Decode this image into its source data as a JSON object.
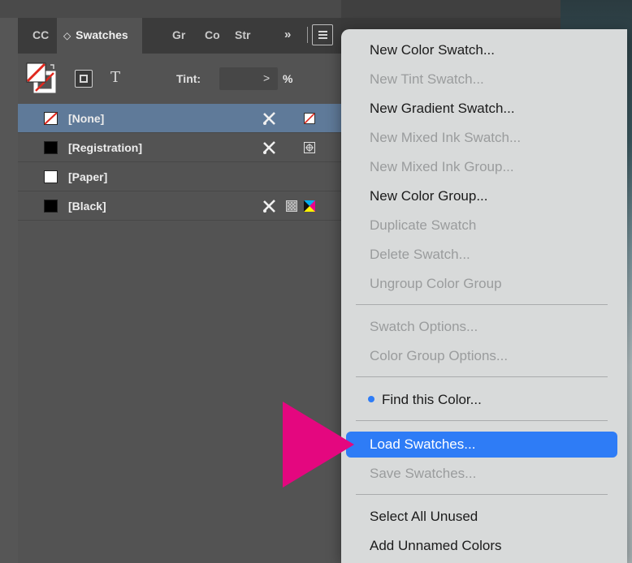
{
  "panel": {
    "tabs": [
      {
        "label": "CC"
      },
      {
        "label": "Swatches",
        "active": true,
        "sort_icon": "◇"
      },
      {
        "label": "Gr"
      },
      {
        "label": "Co"
      },
      {
        "label": "Str"
      }
    ],
    "more_label": "»",
    "tint_label": "Tint:",
    "tint_value": "",
    "tint_arrow": ">",
    "tint_percent": "%",
    "text_btn": "T",
    "swatches": [
      {
        "name": "[None]",
        "chip_color": "#ffffff",
        "selected": true,
        "type_icon": "none-icon"
      },
      {
        "name": "[Registration]",
        "chip_color": "#000000",
        "type_icon": "registration-icon"
      },
      {
        "name": "[Paper]",
        "chip_color": "#ffffff"
      },
      {
        "name": "[Black]",
        "chip_color": "#000000",
        "type_icon": "process-cmyk-icon"
      }
    ]
  },
  "menu": {
    "items": [
      {
        "label": "New Color Swatch...",
        "enabled": true
      },
      {
        "label": "New Tint Swatch...",
        "enabled": false
      },
      {
        "label": "New Gradient Swatch...",
        "enabled": true
      },
      {
        "label": "New Mixed Ink Swatch...",
        "enabled": false
      },
      {
        "label": "New Mixed Ink Group...",
        "enabled": false
      },
      {
        "label": "New Color Group...",
        "enabled": true
      },
      {
        "label": "Duplicate Swatch",
        "enabled": false
      },
      {
        "label": "Delete Swatch...",
        "enabled": false
      },
      {
        "label": "Ungroup Color Group",
        "enabled": false
      },
      {
        "label": "Swatch Options...",
        "enabled": false
      },
      {
        "label": "Color Group Options...",
        "enabled": false
      },
      {
        "label": "Find this Color...",
        "enabled": true,
        "bullet": true
      },
      {
        "label": "Load Swatches...",
        "enabled": true,
        "highlighted": true
      },
      {
        "label": "Save Swatches...",
        "enabled": false
      },
      {
        "label": "Select All Unused",
        "enabled": true
      },
      {
        "label": "Add Unnamed Colors",
        "enabled": true
      }
    ]
  },
  "colors": {
    "accent": "#2e7cf6",
    "pointer_arrow": "#e4077f",
    "selected_row": "#5f7a99",
    "panel_bg": "#535353"
  }
}
